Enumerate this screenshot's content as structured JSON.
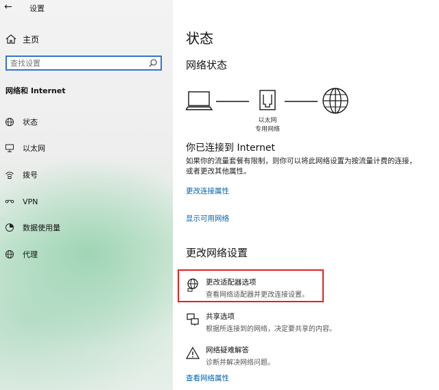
{
  "window": {
    "title": "设置"
  },
  "sidebar": {
    "home_label": "主页",
    "search_placeholder": "查找设置",
    "section_title": "网络和 Internet",
    "items": [
      {
        "label": "状态",
        "icon": "status-globe-icon"
      },
      {
        "label": "以太网",
        "icon": "ethernet-icon"
      },
      {
        "label": "拨号",
        "icon": "dialup-icon"
      },
      {
        "label": "VPN",
        "icon": "vpn-icon"
      },
      {
        "label": "数据使用量",
        "icon": "data-usage-icon"
      },
      {
        "label": "代理",
        "icon": "proxy-globe-icon"
      }
    ]
  },
  "main": {
    "title": "状态",
    "network_status_title": "网络状态",
    "diagram": {
      "adapter_label": "以太网",
      "network_label": "专用网络"
    },
    "connected_title": "你已连接到 Internet",
    "connected_desc": "如果你的流量套餐有限制，则你可以将此网络设置为按流量计费的连接，或者更改其他属性。",
    "link_change_props": "更改连接属性",
    "link_show_networks": "显示可用网络",
    "change_settings_title": "更改网络设置",
    "options": [
      {
        "title": "更改适配器选项",
        "desc": "查看网络适配器并更改连接设置。",
        "icon": "adapter-globe-icon"
      },
      {
        "title": "共享选项",
        "desc": "根据所连接到的网络，决定要共享的内容。",
        "icon": "sharing-icon"
      },
      {
        "title": "网络疑难解答",
        "desc": "诊断并解决网络问题。",
        "icon": "warning-icon"
      }
    ],
    "link_hardware_props": "查看网络属性"
  },
  "colors": {
    "accent": "#0063b1",
    "search_border": "#2f74d0",
    "highlight": "#e02020"
  }
}
